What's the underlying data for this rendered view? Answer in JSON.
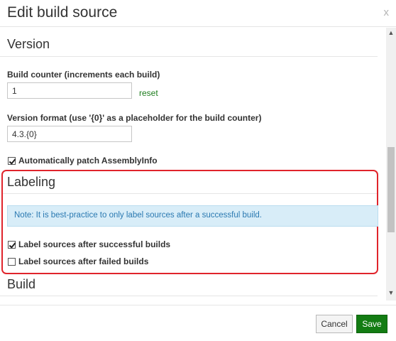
{
  "dialog": {
    "title": "Edit build source",
    "close_glyph": "x"
  },
  "version_section": {
    "title": "Version",
    "build_counter_label": "Build counter (increments each build)",
    "build_counter_value": "1",
    "reset_label": "reset",
    "version_format_label": "Version format (use '{0}' as a placeholder for the build counter)",
    "version_format_value": "4.3.{0}",
    "patch_assemblyinfo_label": "Automatically patch AssemblyInfo",
    "patch_assemblyinfo_checked": true
  },
  "labeling_section": {
    "title": "Labeling",
    "note": "Note: It is best-practice to only label sources after a successful build.",
    "label_success_label": "Label sources after successful builds",
    "label_success_checked": true,
    "label_failed_label": "Label sources after failed builds",
    "label_failed_checked": false,
    "highlight_color": "#e0242b"
  },
  "build_section": {
    "title": "Build"
  },
  "scrollbar": {
    "up_glyph": "▲",
    "down_glyph": "▼"
  },
  "footer": {
    "cancel_label": "Cancel",
    "save_label": "Save"
  },
  "colors": {
    "save_button": "#137c13",
    "reset_link": "#1e7d1e",
    "note_background": "#d8edf8",
    "note_text": "#2a79b1"
  }
}
